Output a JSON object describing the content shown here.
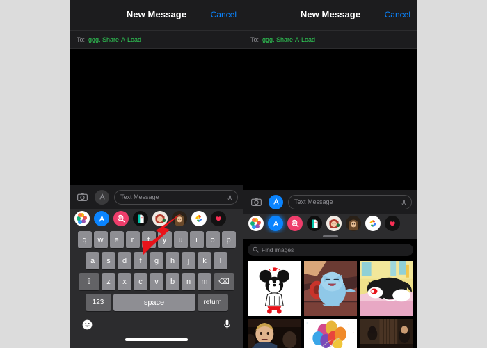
{
  "meta": {
    "platform": "ios-messages",
    "background_color": "#dcdcdc",
    "accent_blue": "#0a84ff",
    "recipient_green": "#30d158",
    "annotation_color": "#e8131a"
  },
  "panels": [
    {
      "id": "left",
      "navbar": {
        "title": "New Message",
        "cancel_label": "Cancel"
      },
      "to_field": {
        "label": "To:",
        "value": "ggg, Share-A-Load"
      },
      "input_bar": {
        "camera_icon": "camera-icon",
        "apps_icon": "app-store-icon",
        "apps_active": false,
        "placeholder": "Text Message",
        "value": "",
        "mic_icon": "microphone-icon"
      },
      "app_drawer": {
        "apps": [
          {
            "name": "photos-app",
            "icon": "photos-flower-icon",
            "selected": false
          },
          {
            "name": "app-store-app",
            "icon": "app-store-icon",
            "selected": false
          },
          {
            "name": "images-app",
            "icon": "images-search-icon",
            "selected": false
          },
          {
            "name": "document-app",
            "icon": "document-icon",
            "selected": false
          },
          {
            "name": "memoji-sticker-app",
            "icon": "memoji-red-icon",
            "selected": false
          },
          {
            "name": "memoji-app",
            "icon": "memoji-brown-icon",
            "selected": false
          },
          {
            "name": "google-photos-app",
            "icon": "google-photos-icon",
            "selected": false
          },
          {
            "name": "music-app",
            "icon": "music-heart-icon",
            "selected": false
          }
        ]
      },
      "keyboard": {
        "row1": [
          "q",
          "w",
          "e",
          "r",
          "t",
          "y",
          "u",
          "i",
          "o",
          "p"
        ],
        "row2": [
          "a",
          "s",
          "d",
          "f",
          "g",
          "h",
          "j",
          "k",
          "l"
        ],
        "row3": [
          "z",
          "x",
          "c",
          "v",
          "b",
          "n",
          "m"
        ],
        "shift_label": "⇧",
        "delete_label": "⌫",
        "numbers_label": "123",
        "space_label": "space",
        "return_label": "return",
        "emoji_icon": "emoji-smiley-icon",
        "dictation_icon": "microphone-icon"
      },
      "annotation": {
        "type": "arrow",
        "points_to": "app-store-app",
        "color": "#e8131a"
      }
    },
    {
      "id": "right",
      "navbar": {
        "title": "New Message",
        "cancel_label": "Cancel"
      },
      "to_field": {
        "label": "To:",
        "value": "ggg, Share-A-Load"
      },
      "input_bar": {
        "camera_icon": "camera-icon",
        "apps_icon": "app-store-icon",
        "apps_active": true,
        "placeholder": "Text Message",
        "value": "",
        "mic_icon": "microphone-icon"
      },
      "app_drawer": {
        "apps": [
          {
            "name": "photos-app",
            "icon": "photos-flower-icon",
            "selected": false
          },
          {
            "name": "app-store-app",
            "icon": "app-store-icon",
            "selected": false
          },
          {
            "name": "images-app",
            "icon": "images-search-icon",
            "selected": true
          },
          {
            "name": "document-app",
            "icon": "document-icon",
            "selected": false
          },
          {
            "name": "memoji-sticker-app",
            "icon": "memoji-red-icon",
            "selected": false
          },
          {
            "name": "memoji-app",
            "icon": "memoji-brown-icon",
            "selected": false
          },
          {
            "name": "google-photos-app",
            "icon": "google-photos-icon",
            "selected": false
          },
          {
            "name": "music-app",
            "icon": "music-heart-icon",
            "selected": false
          }
        ]
      },
      "image_picker": {
        "search": {
          "placeholder": "Find images",
          "value": "",
          "icon": "search-icon"
        },
        "results": [
          {
            "name": "thumb-minnie-mouse",
            "alt": "Minnie Mouse cartoon on white"
          },
          {
            "name": "thumb-blue-cat",
            "alt": "Blue cartoon cat"
          },
          {
            "name": "thumb-sylvester-cat",
            "alt": "Black and white cartoon cat"
          },
          {
            "name": "thumb-man-crowd",
            "alt": "Man in a crowd"
          },
          {
            "name": "thumb-balloons",
            "alt": "Colorful balloons on white"
          },
          {
            "name": "thumb-man-hallway",
            "alt": "Man walking in hallway"
          }
        ]
      }
    }
  ]
}
